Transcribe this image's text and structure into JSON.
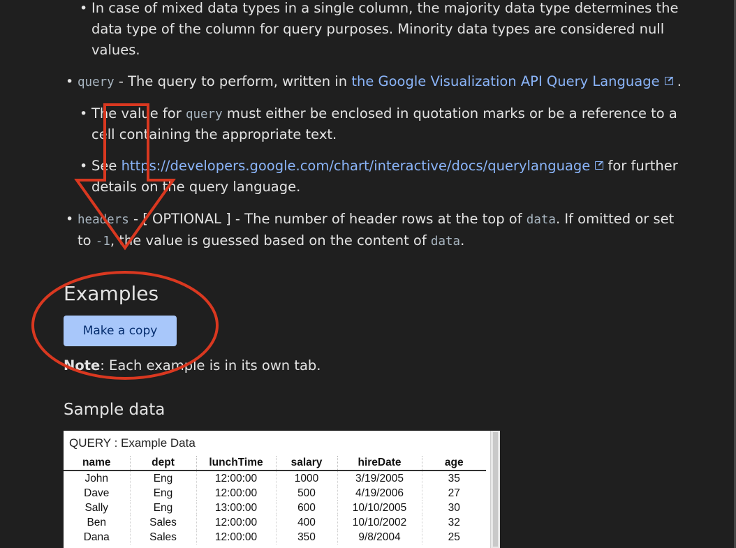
{
  "doc": {
    "mixed_line1": "In case of mixed data types in a single column, the majority data type determines the",
    "mixed_line2": "data type of the column for query purposes. Minority data types are considered null",
    "mixed_line3": "values.",
    "query_param": "query",
    "query_desc": " - The query to perform, written in ",
    "query_link": "the Google Visualization API Query Language",
    "query_end": ".",
    "value_pre": "The value for ",
    "value_code": "query",
    "value_post": " must either be enclosed in quotation marks or be a reference to a",
    "value_line2": "cell containing the appropriate text.",
    "see_pre": "See ",
    "see_link": "https://developers.google.com/chart/interactive/docs/querylanguage",
    "see_post": " for further",
    "see_line2": "details on the query language.",
    "headers_param": "headers",
    "headers_optional_pre": " - ",
    "headers_optional": "[ OPTIONAL ]",
    "headers_desc": " - The number of header rows at the top of ",
    "headers_code1": "data",
    "headers_desc2": ". If omitted or set",
    "headers_line2_pre": "to ",
    "headers_code2": "-1",
    "headers_line2_mid": ", the value is guessed based on the content of ",
    "headers_code3": "data",
    "headers_line2_end": "."
  },
  "examples": {
    "heading": "Examples",
    "button": "Make a copy",
    "note_bold": "Note",
    "note_text": ": Each example is in its own tab.",
    "sample_heading": "Sample data"
  },
  "sheet": {
    "title": "QUERY : Example Data",
    "columns": [
      "name",
      "dept",
      "lunchTime",
      "salary",
      "hireDate",
      "age"
    ],
    "rows": [
      [
        "John",
        "Eng",
        "12:00:00",
        "1000",
        "3/19/2005",
        "35"
      ],
      [
        "Dave",
        "Eng",
        "12:00:00",
        "500",
        "4/19/2006",
        "27"
      ],
      [
        "Sally",
        "Eng",
        "13:00:00",
        "600",
        "10/10/2005",
        "30"
      ],
      [
        "Ben",
        "Sales",
        "12:00:00",
        "400",
        "10/10/2002",
        "32"
      ],
      [
        "Dana",
        "Sales",
        "12:00:00",
        "350",
        "9/8/2004",
        "25"
      ]
    ]
  },
  "colors": {
    "background": "#1f1f1f",
    "link": "#8ab4f8",
    "button": "#a8c7fa",
    "annotation": "#d93820"
  },
  "icons": [
    "external-link-icon",
    "down-arrow-annotation",
    "ellipse-annotation"
  ]
}
